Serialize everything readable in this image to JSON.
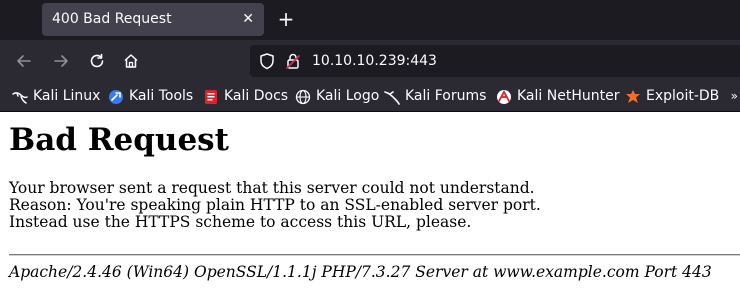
{
  "tab": {
    "title": "400 Bad Request",
    "close_glyph": "✕"
  },
  "newtab_glyph": "+",
  "nav": {
    "url": "10.10.10.239:443"
  },
  "bookmarks": [
    {
      "label": "Kali Linux",
      "icon": "kali-dragon-icon"
    },
    {
      "label": "Kali Tools",
      "icon": "kali-tools-icon"
    },
    {
      "label": "Kali Docs",
      "icon": "kali-docs-icon"
    },
    {
      "label": "Kali Logo",
      "icon": "globe-icon"
    },
    {
      "label": "Kali Forums",
      "icon": "kali-forums-icon"
    },
    {
      "label": "Kali NetHunter",
      "icon": "nethunter-icon"
    },
    {
      "label": "Exploit-DB",
      "icon": "exploit-db-icon"
    }
  ],
  "bookmarks_more": "»",
  "page": {
    "heading": "Bad Request",
    "lines": [
      "Your browser sent a request that this server could not understand.",
      "Reason: You're speaking plain HTTP to an SSL-enabled server port.",
      "Instead use the HTTPS scheme to access this URL, please."
    ],
    "address": "Apache/2.4.46 (Win64) OpenSSL/1.1.1j PHP/7.3.27 Server at www.example.com Port 443"
  },
  "colors": {
    "tabstrip_bg": "#1c1b22",
    "toolbar_bg": "#2b2a33",
    "active_tab_bg": "#42414d",
    "urlbar_bg": "#1c1b22",
    "text_light": "#fbfbfe",
    "lock_warning": "#e22850"
  }
}
